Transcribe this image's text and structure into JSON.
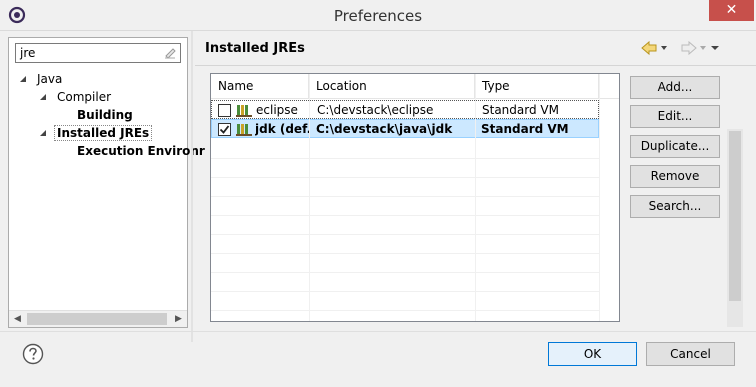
{
  "window": {
    "title": "Preferences",
    "close_label": "✕"
  },
  "filter": {
    "value": "jre"
  },
  "tree": {
    "items": [
      {
        "label": "Java",
        "level": 0,
        "expanded": true,
        "bold": false
      },
      {
        "label": "Compiler",
        "level": 1,
        "expanded": true,
        "bold": false
      },
      {
        "label": "Building",
        "level": 2,
        "expanded": false,
        "bold": true
      },
      {
        "label": "Installed JREs",
        "level": 1,
        "expanded": true,
        "bold": true,
        "selected": true
      },
      {
        "label": "Execution Environr",
        "level": 2,
        "expanded": false,
        "bold": true
      }
    ]
  },
  "page": {
    "title": "Installed JREs"
  },
  "table": {
    "headers": [
      "Name",
      "Location",
      "Type"
    ],
    "rows": [
      {
        "checked": false,
        "name": "eclipse",
        "location": "C:\\devstack\\eclipse",
        "type": "Standard VM",
        "selected": false,
        "bold": false
      },
      {
        "checked": true,
        "name": "jdk (def...",
        "location": "C:\\devstack\\java\\jdk",
        "type": "Standard VM",
        "selected": true,
        "bold": true
      }
    ]
  },
  "buttons": {
    "add": "Add...",
    "edit": "Edit...",
    "duplicate": "Duplicate...",
    "remove": "Remove",
    "search": "Search...",
    "ok": "OK",
    "cancel": "Cancel"
  },
  "colors": {
    "selection": "#cce8ff",
    "close": "#c7504b",
    "accent": "#0078d7"
  }
}
